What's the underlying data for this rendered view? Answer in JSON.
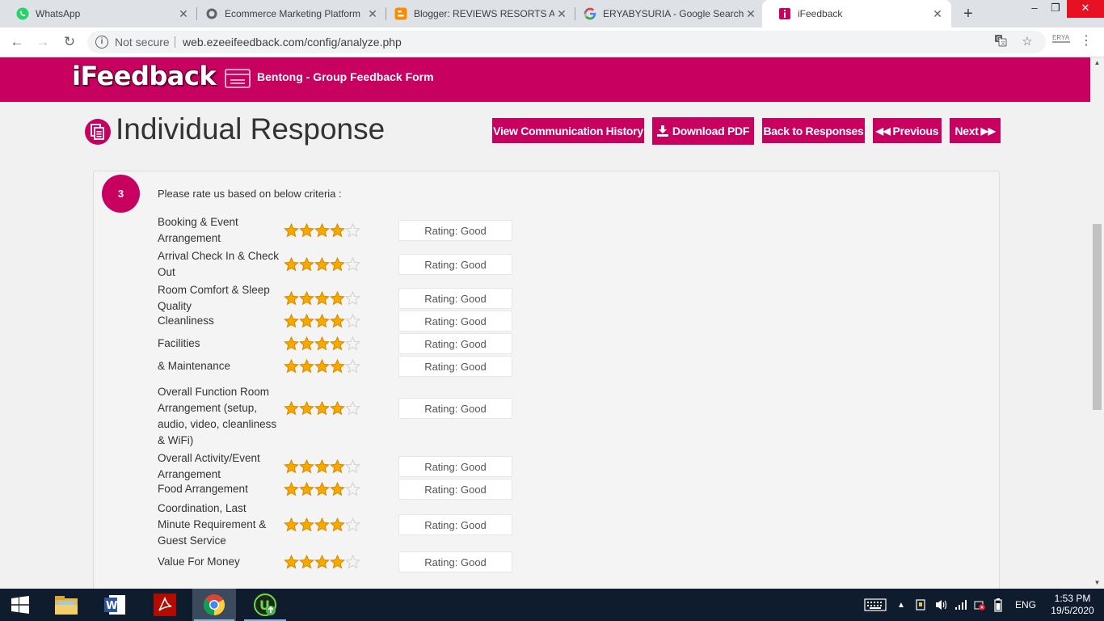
{
  "browser": {
    "tabs": [
      {
        "title": "WhatsApp",
        "icon": "whatsapp-icon"
      },
      {
        "title": "Ecommerce Marketing Platform",
        "icon": "shopify-icon"
      },
      {
        "title": "Blogger: REVIEWS RESORTS AND",
        "icon": "blogger-icon"
      },
      {
        "title": "ERYABYSURIA - Google Search",
        "icon": "google-icon"
      },
      {
        "title": "iFeedback",
        "icon": "ifeedback-icon"
      }
    ],
    "security_label": "Not secure",
    "url": "web.ezeeifeedback.com/config/analyze.php",
    "profile_label": "ERYA"
  },
  "header": {
    "logo": "iFeedback",
    "form_title": "Bentong - Group Feedback Form"
  },
  "page": {
    "title": "Individual Response",
    "buttons": {
      "view_history": "View Communication History",
      "download_pdf": "Download PDF",
      "back": "Back to Responses",
      "previous": "Previous",
      "next": "Next"
    },
    "question_number": "3",
    "question_text": "Please rate us based on below criteria :",
    "ratings": [
      {
        "label": "Booking & Event Arrangement",
        "stars": 4,
        "max": 5,
        "rating": "Rating: Good"
      },
      {
        "label": "Arrival Check In & Check Out",
        "stars": 4,
        "max": 5,
        "rating": "Rating: Good"
      },
      {
        "label": "Room Comfort & Sleep Quality",
        "stars": 4,
        "max": 5,
        "rating": "Rating: Good"
      },
      {
        "label": "Cleanliness",
        "stars": 4,
        "max": 5,
        "rating": "Rating: Good"
      },
      {
        "label": "Facilities",
        "stars": 4,
        "max": 5,
        "rating": "Rating: Good"
      },
      {
        "label": "& Maintenance",
        "stars": 4,
        "max": 5,
        "rating": "Rating: Good"
      },
      {
        "label": "Overall Function Room Arrangement (setup, audio, video, cleanliness & WiFi)",
        "stars": 4,
        "max": 5,
        "rating": "Rating: Good"
      },
      {
        "label": "Overall Activity/Event Arrangement",
        "stars": 4,
        "max": 5,
        "rating": "Rating: Good"
      },
      {
        "label": "Food Arrangement",
        "stars": 4,
        "max": 5,
        "rating": "Rating: Good"
      },
      {
        "label": "Coordination, Last Minute Requirement & Guest Service",
        "stars": 4,
        "max": 5,
        "rating": "Rating: Good"
      },
      {
        "label": "Value For Money",
        "stars": 4,
        "max": 5,
        "rating": "Rating: Good"
      }
    ]
  },
  "taskbar": {
    "language": "ENG",
    "time": "1:53 PM",
    "date": "19/5/2020"
  },
  "colors": {
    "brand": "#c8005f",
    "star_filled": "#f5a800",
    "star_empty": "#d0d0d0",
    "taskbar": "#0f1c2e"
  }
}
